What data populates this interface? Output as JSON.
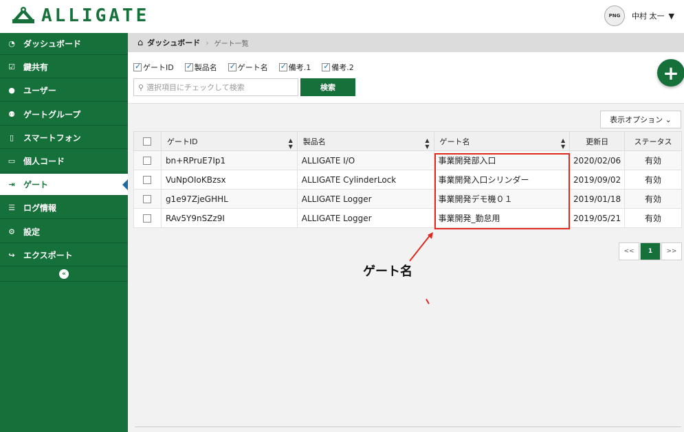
{
  "app": {
    "logo_text": "ALLIGATE"
  },
  "user": {
    "avatar_label": "PNG",
    "name": "中村 太一"
  },
  "sidebar": {
    "items": [
      {
        "label": "ダッシュボード",
        "icon": "dashboard-icon",
        "glyph": "◔",
        "active": false
      },
      {
        "label": "鍵共有",
        "icon": "check-square-icon",
        "glyph": "☑",
        "active": false
      },
      {
        "label": "ユーザー",
        "icon": "user-icon",
        "glyph": "●",
        "active": false
      },
      {
        "label": "ゲートグループ",
        "icon": "users-icon",
        "glyph": "⚉",
        "active": false
      },
      {
        "label": "スマートフォン",
        "icon": "smartphone-icon",
        "glyph": "▯",
        "active": false
      },
      {
        "label": "個人コード",
        "icon": "credit-card-icon",
        "glyph": "▭",
        "active": false
      },
      {
        "label": "ゲート",
        "icon": "sign-in-icon",
        "glyph": "⇥",
        "active": true
      },
      {
        "label": "ログ情報",
        "icon": "list-icon",
        "glyph": "☰",
        "active": false
      },
      {
        "label": "設定",
        "icon": "gear-icon",
        "glyph": "⚙",
        "active": false
      },
      {
        "label": "エクスポート",
        "icon": "share-icon",
        "glyph": "↪",
        "active": false
      }
    ],
    "collapse_glyph": "«"
  },
  "breadcrumb": {
    "root": "ダッシュボード",
    "separator": "›",
    "current": "ゲート一覧"
  },
  "filters": {
    "columns": [
      {
        "label": "ゲートID",
        "checked": true
      },
      {
        "label": "製品名",
        "checked": true
      },
      {
        "label": "ゲート名",
        "checked": true
      },
      {
        "label": "備考.1",
        "checked": true
      },
      {
        "label": "備考.2",
        "checked": true
      }
    ],
    "search_placeholder": "選択項目にチェックして検索",
    "search_button": "検索"
  },
  "add_button": "+",
  "display_options": "表示オプション ⌄",
  "table": {
    "headers": [
      "ゲートID",
      "製品名",
      "ゲート名",
      "更新日",
      "ステータス"
    ],
    "rows": [
      {
        "id": "bn+RPruE7Ip1",
        "product": "ALLIGATE I/O",
        "name": "事業開発部入口",
        "updated": "2020/02/06",
        "status": "有効"
      },
      {
        "id": "VuNpOIoKBzsx",
        "product": "ALLIGATE CylinderLock",
        "name": "事業開発入口シリンダー",
        "updated": "2019/09/02",
        "status": "有効"
      },
      {
        "id": "g1e97ZjeGHHL",
        "product": "ALLIGATE Logger",
        "name": "事業開発デモ機０１",
        "updated": "2019/01/18",
        "status": "有効"
      },
      {
        "id": "RAv5Y9nSZz9I",
        "product": "ALLIGATE Logger",
        "name": "事業開発_勤怠用",
        "updated": "2019/05/21",
        "status": "有効"
      }
    ]
  },
  "pager": {
    "prev": "<<",
    "current": "1",
    "next": ">>"
  },
  "annotation": {
    "label": "ゲート名",
    "color": "#e0281e"
  },
  "colors": {
    "brand": "#15703a",
    "highlight": "#e0281e"
  }
}
